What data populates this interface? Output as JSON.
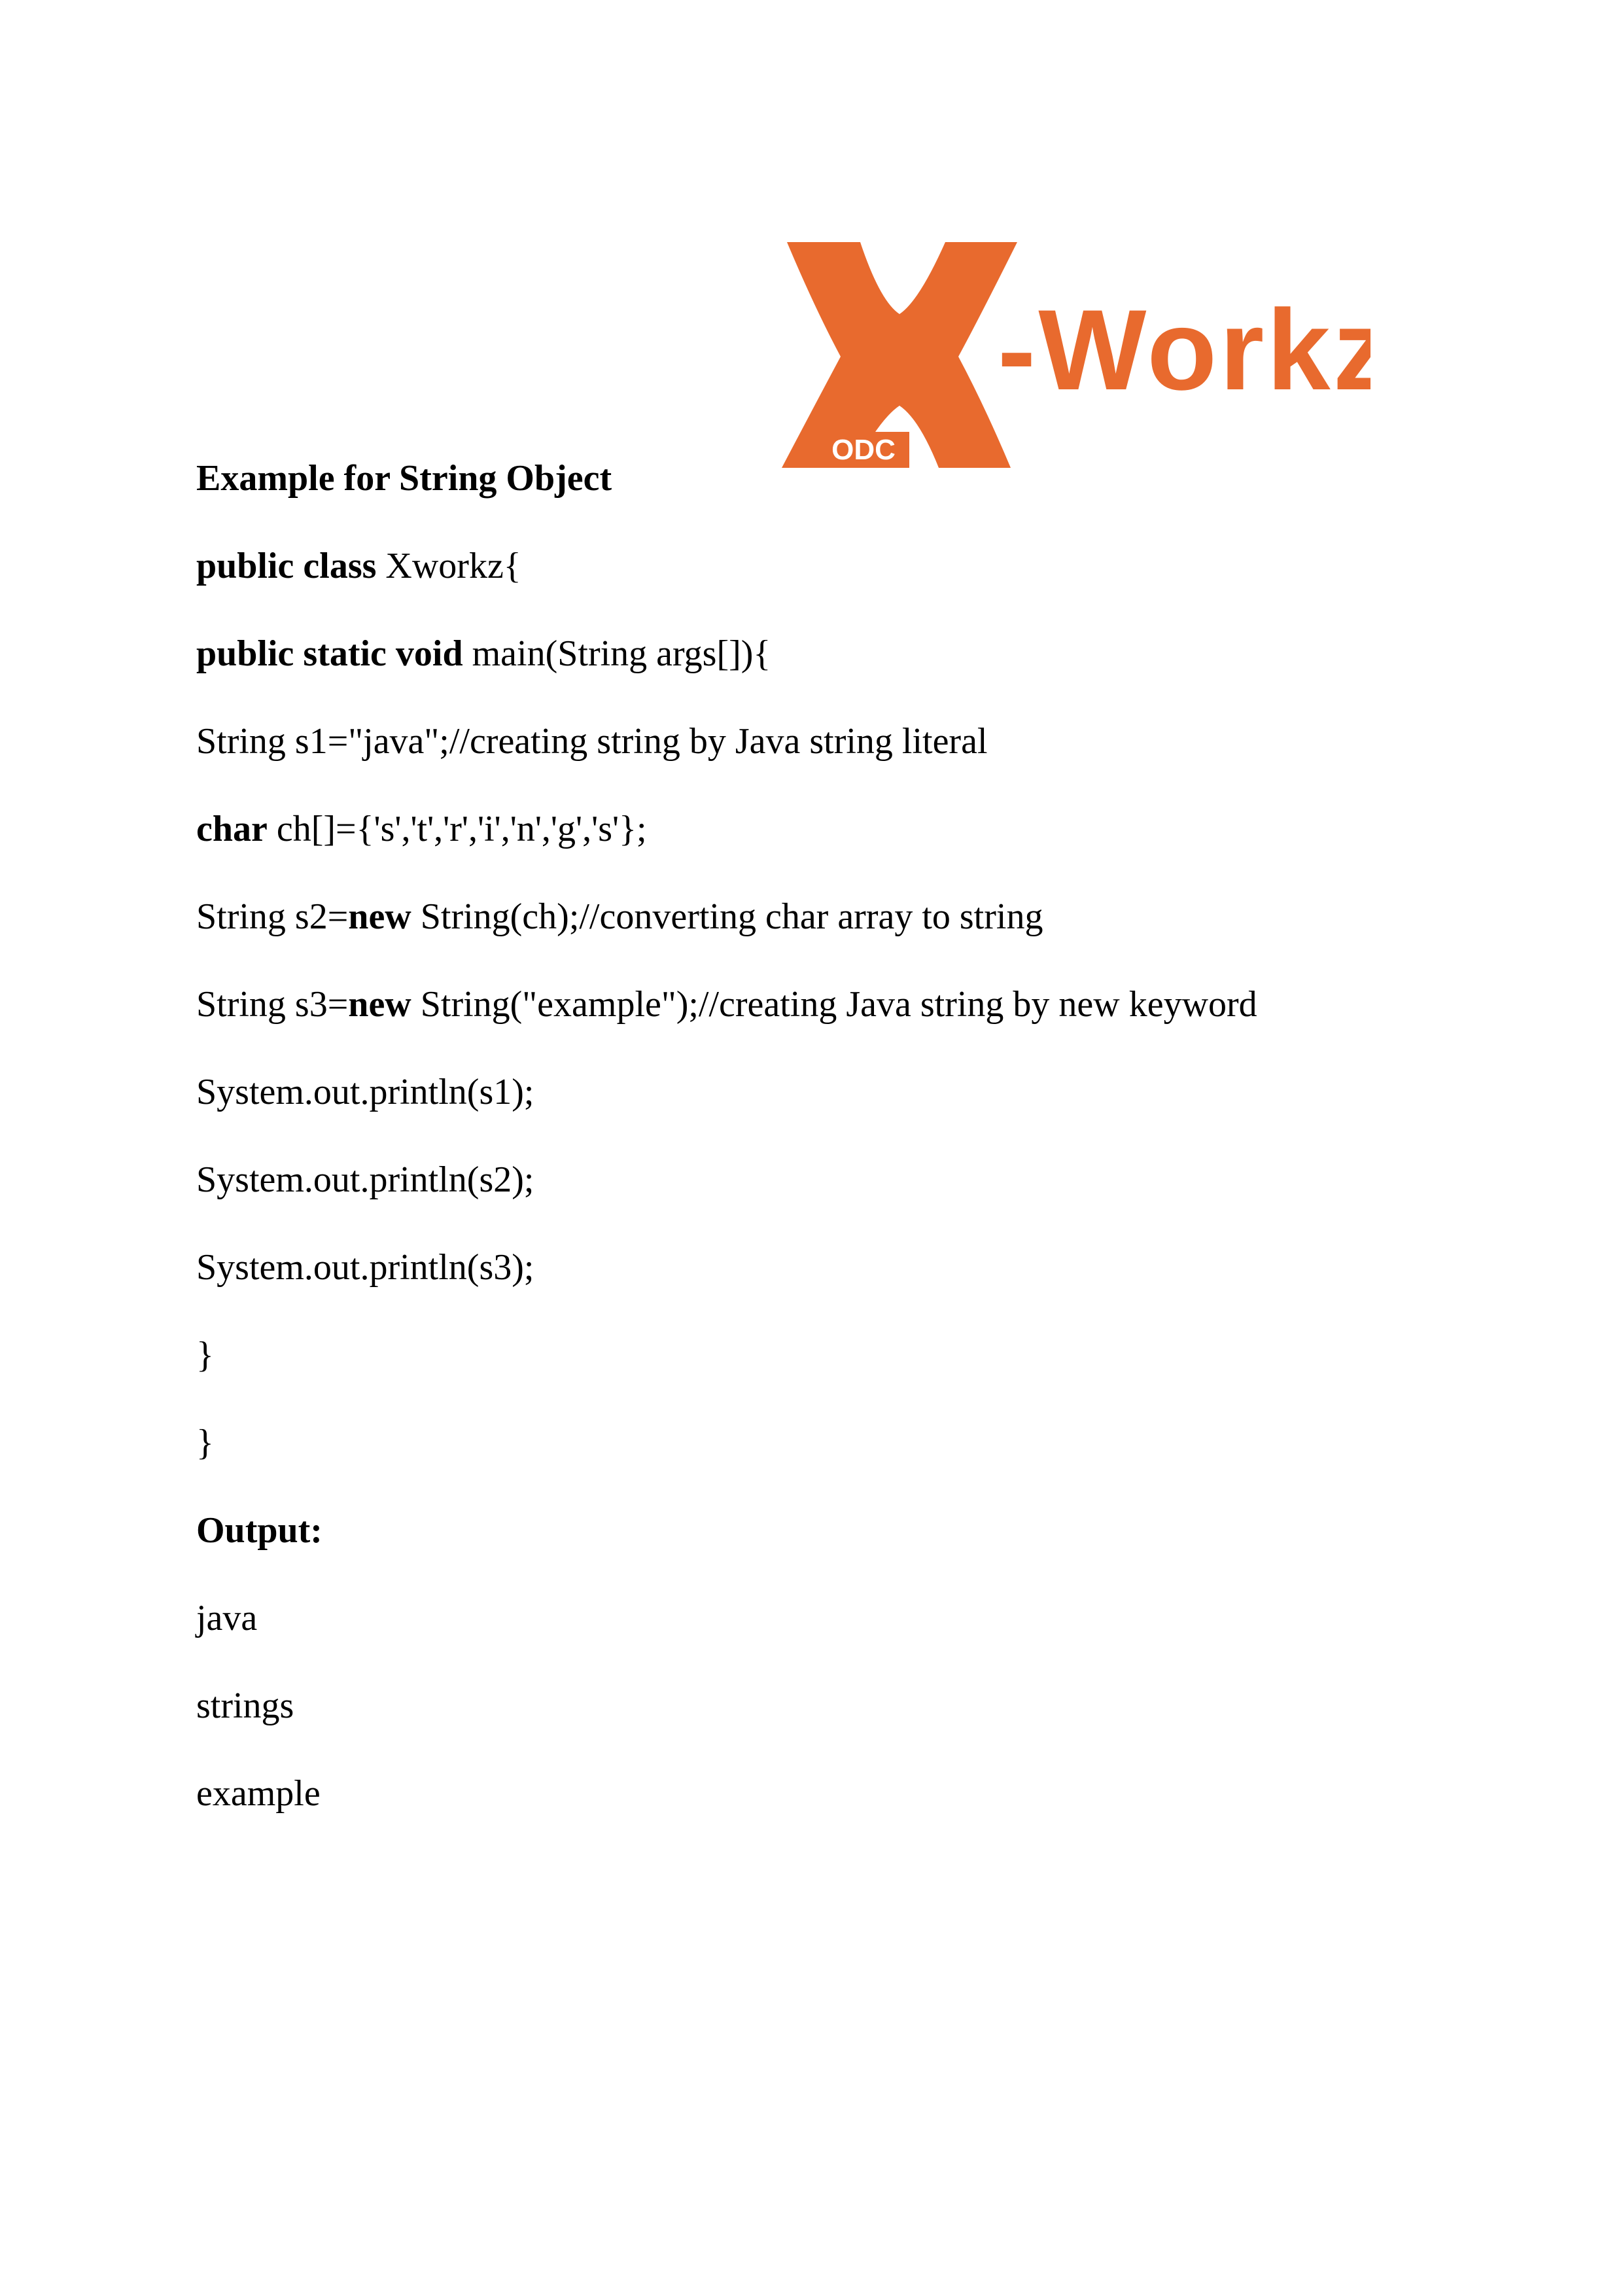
{
  "logo": {
    "brand_text": "-Workz",
    "sub_text": "ODC",
    "brand_color": "#e86a2e"
  },
  "document": {
    "title": "Example for String Object",
    "code": {
      "l1_kw": "public class",
      "l1_rest": " Xworkz{",
      "l2_kw": "public static void",
      "l2_rest": " main(String args[]){",
      "l3": "String s1=\"java\";//creating string by Java string literal",
      "l4_kw": "char",
      "l4_rest": " ch[]={'s','t','r','i','n','g','s'};",
      "l5_pre": "String s2=",
      "l5_kw": "new",
      "l5_rest": " String(ch);//converting char array to string",
      "l6_pre": "String s3=",
      "l6_kw": "new",
      "l6_rest": " String(\"example\");//creating Java string by new keyword",
      "l7": "System.out.println(s1);",
      "l8": "System.out.println(s2);",
      "l9": "System.out.println(s3);",
      "l10": "}",
      "l11": "}"
    },
    "output_heading": "Output:",
    "output_lines": [
      "java",
      "strings",
      "example"
    ]
  }
}
